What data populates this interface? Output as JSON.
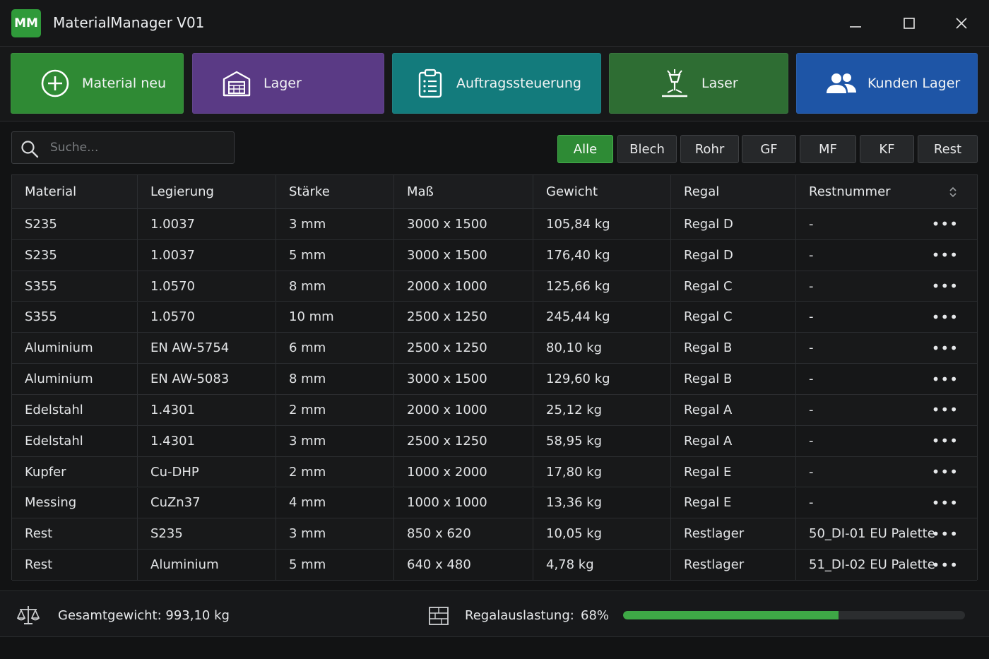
{
  "app": {
    "logo": "MM",
    "title": "MaterialManager V01"
  },
  "window_controls": [
    "minimize-icon",
    "maximize-icon",
    "close-icon"
  ],
  "nav": [
    {
      "label": "Material neu",
      "icon": "plus-circle-icon",
      "color": "#2f8a34"
    },
    {
      "label": "Lager",
      "icon": "warehouse-icon",
      "color": "#5a3a85"
    },
    {
      "label": "Auftragssteuerung",
      "icon": "clipboard-list-icon",
      "color": "#137b7c"
    },
    {
      "label": "Laser",
      "icon": "laser-icon",
      "color": "#2e6d33"
    },
    {
      "label": "Kunden Lager",
      "icon": "users-icon",
      "color": "#1e55a6"
    }
  ],
  "search": {
    "placeholder": "Suche..."
  },
  "filters": [
    {
      "label": "Alle",
      "active": true
    },
    {
      "label": "Blech",
      "active": false
    },
    {
      "label": "Rohr",
      "active": false
    },
    {
      "label": "GF",
      "active": false
    },
    {
      "label": "MF",
      "active": false
    },
    {
      "label": "KF",
      "active": false
    },
    {
      "label": "Rest",
      "active": false
    }
  ],
  "table": {
    "columns": [
      "Material",
      "Legierung",
      "Stärke",
      "Maß",
      "Gewicht",
      "Regal",
      "Restnummer"
    ],
    "rows": [
      [
        "S235",
        "1.0037",
        "3 mm",
        "3000 x 1500",
        "105,84 kg",
        "Regal D",
        "-"
      ],
      [
        "S235",
        "1.0037",
        "5 mm",
        "3000 x 1500",
        "176,40 kg",
        "Regal D",
        "-"
      ],
      [
        "S355",
        "1.0570",
        "8 mm",
        "2000 x 1000",
        "125,66 kg",
        "Regal C",
        "-"
      ],
      [
        "S355",
        "1.0570",
        "10 mm",
        "2500 x 1250",
        "245,44 kg",
        "Regal C",
        "-"
      ],
      [
        "Aluminium",
        "EN AW-5754",
        "6 mm",
        "2500 x 1250",
        "80,10 kg",
        "Regal B",
        "-"
      ],
      [
        "Aluminium",
        "EN AW-5083",
        "8 mm",
        "3000 x 1500",
        "129,60 kg",
        "Regal B",
        "-"
      ],
      [
        "Edelstahl",
        "1.4301",
        "2 mm",
        "2000 x 1000",
        "25,12 kg",
        "Regal A",
        "-"
      ],
      [
        "Edelstahl",
        "1.4301",
        "3 mm",
        "2500 x 1250",
        "58,95 kg",
        "Regal A",
        "-"
      ],
      [
        "Kupfer",
        "Cu-DHP",
        "2 mm",
        "1000 x 2000",
        "17,80 kg",
        "Regal E",
        "-"
      ],
      [
        "Messing",
        "CuZn37",
        "4 mm",
        "1000 x 1000",
        "13,36 kg",
        "Regal E",
        "-"
      ],
      [
        "Rest",
        "S235",
        "3 mm",
        "850 x 620",
        "10,05 kg",
        "Restlager",
        "50_DI-01 EU Palette"
      ],
      [
        "Rest",
        "Aluminium",
        "5 mm",
        "640 x 480",
        "4,78 kg",
        "Restlager",
        "51_DI-02 EU Palette"
      ]
    ],
    "row_action": "•••"
  },
  "footer": {
    "total_label": "Gesamtgewicht: 993,10 kg",
    "utilization_label": "Regalauslastung:",
    "utilization_value": "68%",
    "utilization_percent": 63,
    "accent": "#3ea846"
  }
}
